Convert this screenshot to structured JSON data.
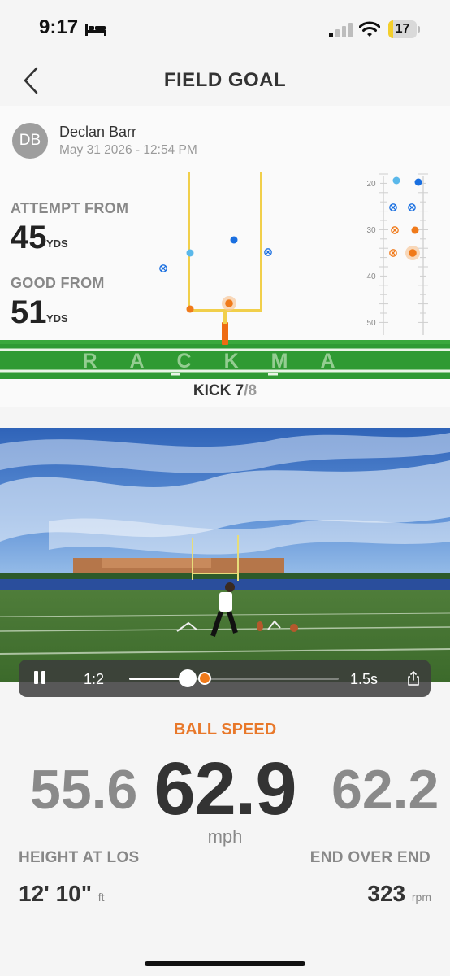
{
  "status_bar": {
    "time": "9:17",
    "battery": "17",
    "battery_level": 0.17,
    "icons": [
      "bed-icon",
      "cellular-signal-icon",
      "wifi-icon",
      "battery-icon"
    ]
  },
  "nav": {
    "title": "FIELD GOAL",
    "back_icon": "chevron-left-icon"
  },
  "kick": {
    "user": {
      "initials": "DB",
      "name": "Declan Barr",
      "date": "May 31 2026 - 12:54 PM"
    },
    "attempt_label": "ATTEMPT FROM",
    "attempt_value": "45",
    "attempt_unit": "YDS",
    "good_label": "GOOD FROM",
    "good_value": "51",
    "good_unit": "YDS",
    "field_text": "RACKMA",
    "counter_label": "KICK",
    "counter_current": "7",
    "counter_total": "/8",
    "yard_lines": [
      "20",
      "30",
      "40",
      "50"
    ]
  },
  "video": {
    "speed": "1:2",
    "duration": "1.5s",
    "progress": 0.28
  },
  "metrics": {
    "ball_speed_label": "BALL SPEED",
    "speed_left": "55.6",
    "speed_main": "62.9",
    "speed_right": "62.2",
    "speed_unit": "mph",
    "height_label": "HEIGHT AT LOS",
    "height_value": "12' 10\"",
    "height_unit": "ft",
    "eoe_label": "END OVER END",
    "eoe_value": "323",
    "eoe_unit": "rpm"
  },
  "colors": {
    "accent_orange": "#f07a1a",
    "light_blue": "#5ab8ea",
    "dark_blue": "#1a6fe0",
    "goalpost_yellow": "#f1cf4a",
    "turf_green": "#2f9a33"
  }
}
